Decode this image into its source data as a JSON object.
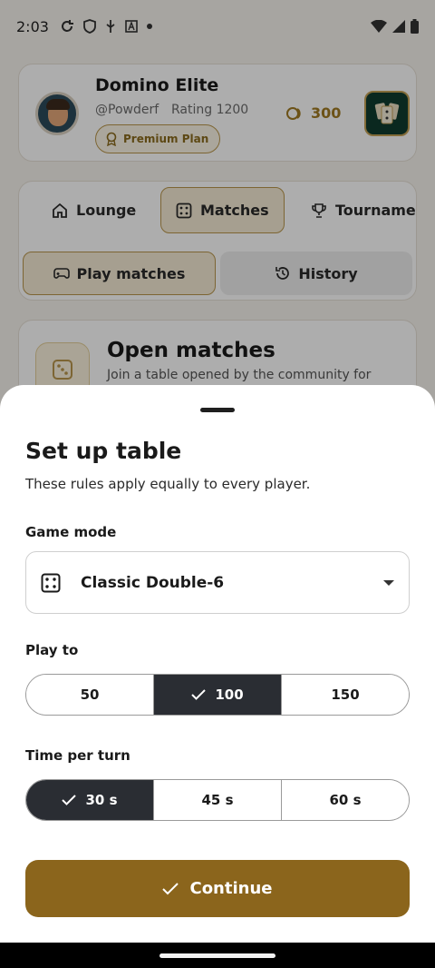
{
  "status_bar": {
    "time": "2:03"
  },
  "profile": {
    "name": "Domino Elite",
    "handle": "@Powderf",
    "rating": "Rating 1200",
    "plan": "Premium Plan",
    "coins": "300"
  },
  "nav": {
    "tabs": [
      {
        "label": "Lounge",
        "icon": "home-icon"
      },
      {
        "label": "Matches",
        "icon": "dice-icon"
      },
      {
        "label": "Tourname…",
        "icon": "trophy-icon"
      }
    ],
    "sub_tabs": [
      {
        "label": "Play matches",
        "icon": "gamepad-icon"
      },
      {
        "label": "History",
        "icon": "history-icon"
      }
    ]
  },
  "open_matches": {
    "title": "Open matches",
    "subtitle": "Join a table opened by the community for"
  },
  "sheet": {
    "title": "Set up table",
    "subtitle": "These rules apply equally to every player.",
    "game_mode": {
      "label": "Game mode",
      "value": "Classic Double-6"
    },
    "play_to": {
      "label": "Play to",
      "options": [
        "50",
        "100",
        "150"
      ],
      "selected": "100"
    },
    "time_per_turn": {
      "label": "Time per turn",
      "options": [
        "30 s",
        "45 s",
        "60 s"
      ],
      "selected": "30 s"
    },
    "continue_label": "Continue"
  },
  "colors": {
    "accent": "#8b651c",
    "selected_segment": "#2a2d33",
    "background": "#f6f3ee"
  }
}
